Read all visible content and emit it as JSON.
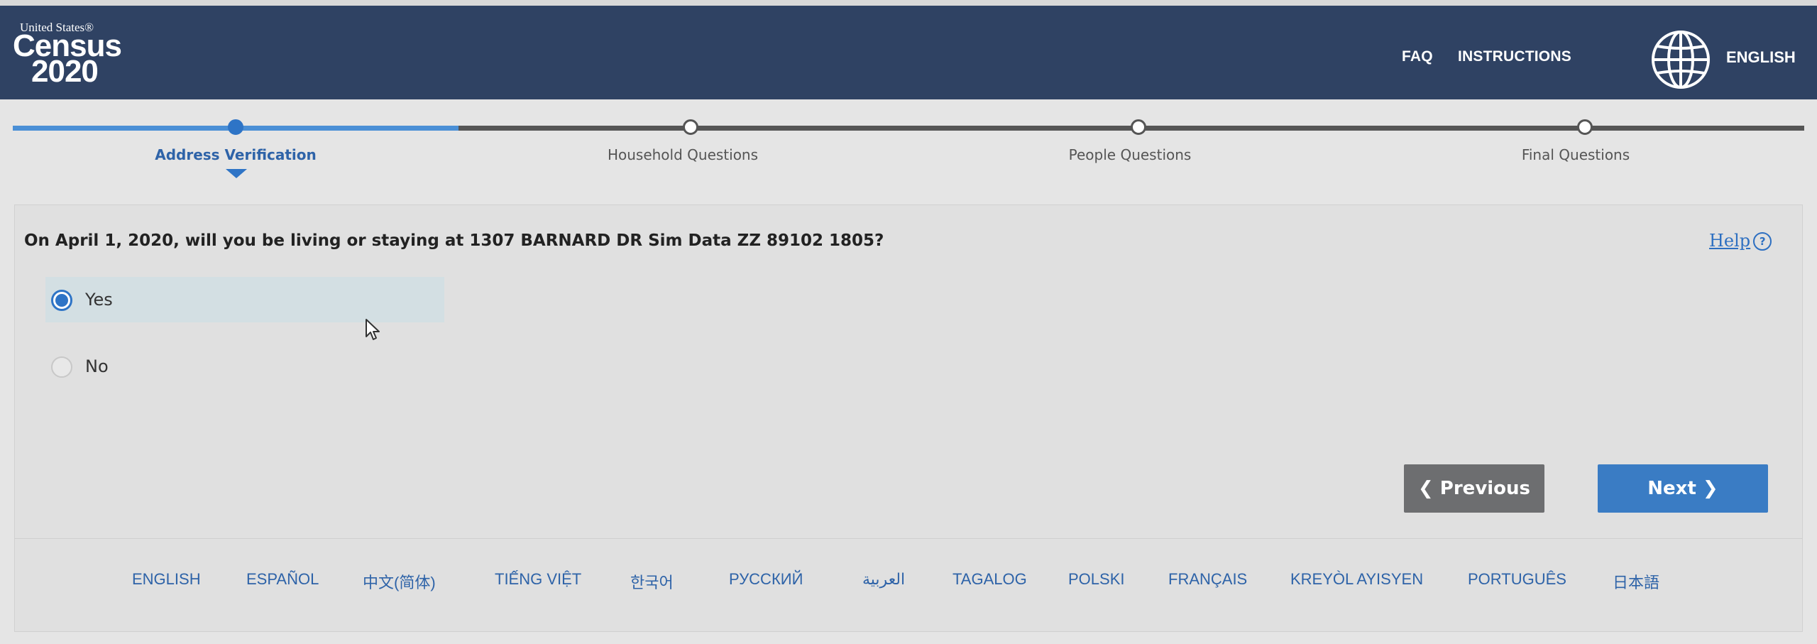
{
  "header": {
    "logo": {
      "united_states": "United States®",
      "census": "Census",
      "year": "2020"
    },
    "nav": {
      "faq": "FAQ",
      "instructions": "INSTRUCTIONS",
      "language": "ENGLISH"
    }
  },
  "steps": [
    {
      "label": "Address Verification",
      "state": "active"
    },
    {
      "label": "Household Questions",
      "state": "upcoming"
    },
    {
      "label": "People Questions",
      "state": "upcoming"
    },
    {
      "label": "Final Questions",
      "state": "upcoming"
    }
  ],
  "question": {
    "text": "On April 1, 2020, will you be living or staying at 1307 BARNARD DR Sim Data ZZ 89102 1805?",
    "help_label": "Help",
    "help_icon": "?",
    "options": [
      {
        "label": "Yes",
        "selected": true
      },
      {
        "label": "No",
        "selected": false
      }
    ]
  },
  "buttons": {
    "previous": "❮ Previous",
    "next": "Next ❯"
  },
  "footer_languages": [
    "ENGLISH",
    "ESPAÑOL",
    "中文(简体)",
    "TIẾNG VIỆT",
    "한국어",
    "РУССКИЙ",
    "العربية",
    "TAGALOG",
    "POLSKI",
    "FRANÇAIS",
    "KREYÒL AYISYEN",
    "PORTUGUÊS",
    "日本語"
  ],
  "colors": {
    "header_bg": "#2f4263",
    "accent_blue": "#2e74c6",
    "prev_button": "#6d6e70",
    "next_button": "#3a7cc4"
  }
}
